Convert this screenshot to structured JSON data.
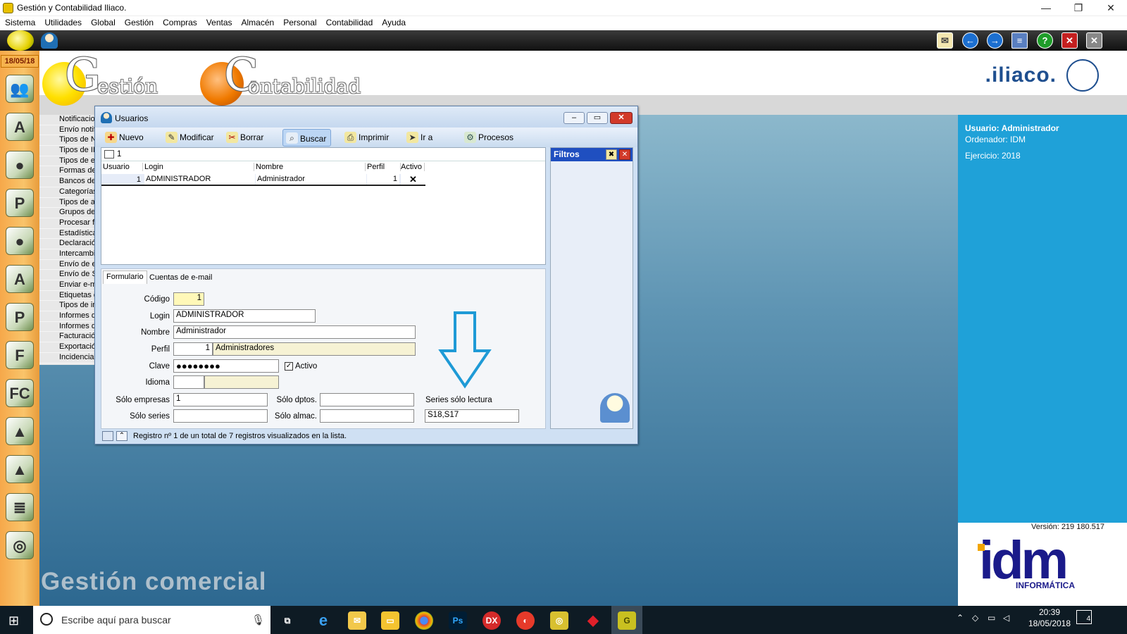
{
  "window": {
    "title": "Gestión y Contabilidad Iliaco."
  },
  "menu": [
    "Sistema",
    "Utilidades",
    "Global",
    "Gestión",
    "Compras",
    "Ventas",
    "Almacén",
    "Personal",
    "Contabilidad",
    "Ayuda"
  ],
  "dock": {
    "date": "18/05/18"
  },
  "banner": {
    "gestion_g": "G",
    "gestion_rest": "estión",
    "contab_c": "C",
    "contab_rest": "ontabilidad",
    "iliaco": ".iliaco."
  },
  "notif_list": [
    "Notificacio",
    "Envío notif",
    "Tipos de N",
    "Tipos de II",
    "Tipos de e",
    "Formas de",
    "Bancos de",
    "Categorías",
    "Tipos de a",
    "Grupos de",
    "Procesar f",
    "Estadística",
    "Declaració",
    "Intercambi",
    "Envío de e",
    "Envío de S",
    "Enviar e-m",
    "Etiquetas c",
    "Tipos de in",
    "Informes d",
    "Informes d",
    "Facturació",
    "Exportació",
    "Incidencia"
  ],
  "usuarios": {
    "title": "Usuarios",
    "toolbar": {
      "nuevo": "Nuevo",
      "modificar": "Modificar",
      "borrar": "Borrar",
      "buscar": "Buscar",
      "imprimir": "Imprimir",
      "ira": "Ir a",
      "procesos": "Procesos"
    },
    "search_value": "1",
    "grid": {
      "headers": [
        "Usuario",
        "Login",
        "Nombre",
        "Perfil",
        "Activo"
      ],
      "row": {
        "usuario": "1",
        "login": "ADMINISTRADOR",
        "nombre": "Administrador",
        "perfil": "1",
        "activo": "✕"
      }
    },
    "filtros": "Filtros",
    "tabs": {
      "formulario": "Formulario",
      "cuentas": "Cuentas de e-mail"
    },
    "form": {
      "codigo_label": "Código",
      "codigo": "1",
      "login_label": "Login",
      "login": "ADMINISTRADOR",
      "nombre_label": "Nombre",
      "nombre": "Administrador",
      "perfil_label": "Perfil",
      "perfil_id": "1",
      "perfil_name": "Administradores",
      "clave_label": "Clave",
      "clave": "●●●●●●●●",
      "activo_label": "Activo",
      "idioma_label": "Idioma",
      "solo_empresas_label": "Sólo empresas",
      "solo_empresas": "1",
      "solo_dptos_label": "Sólo dptos.",
      "series_lectura_label": "Series sólo lectura",
      "series_lectura": "S18,S17",
      "solo_series_label": "Sólo series",
      "solo_almac_label": "Sólo almac."
    },
    "status": "Registro nº 1 de un total de 7 registros visualizados en la lista."
  },
  "info": {
    "usuario": "Usuario: Administrador",
    "ordenador": "Ordenador: IDM",
    "ejercicio": "Ejercicio: 2018",
    "version": "Versión: 219 180.517",
    "idm": "idm",
    "idm_sub": "INFORMÁTICA"
  },
  "watermark": "Gestión comercial",
  "taskbar": {
    "search_placeholder": "Escribe aquí para buscar",
    "time": "20:39",
    "date": "18/05/2018",
    "notif_count": "4"
  }
}
